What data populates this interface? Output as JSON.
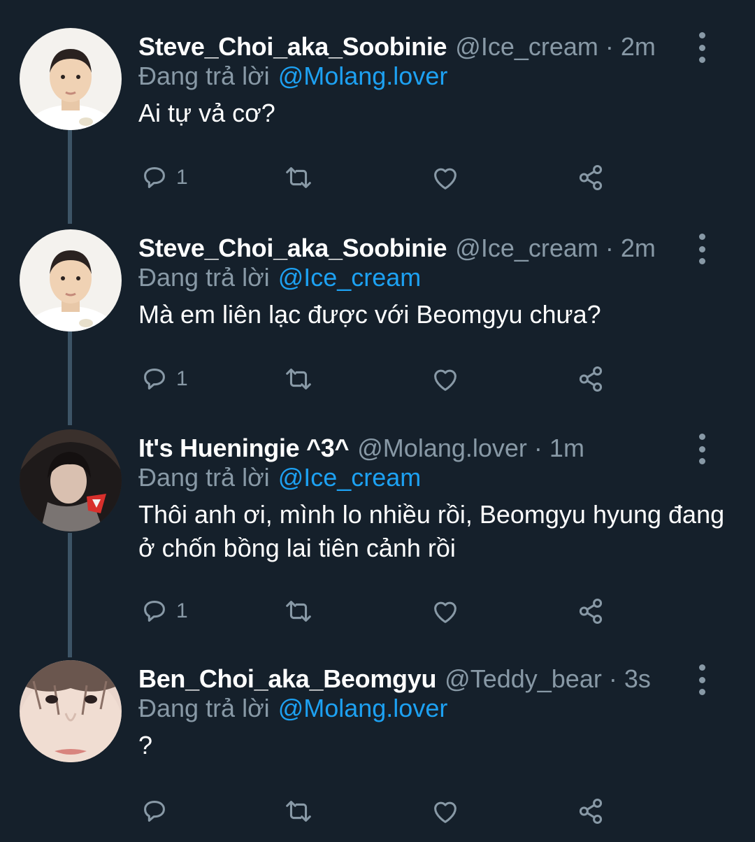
{
  "tweets": [
    {
      "display_name": "Steve_Choi_aka_Soobinie",
      "handle": "@Ice_cream",
      "separator": "·",
      "time": "2m",
      "reply_prefix": "Đang trả lời",
      "reply_target": "@Molang.lover",
      "text": "Ai tự vả cơ?",
      "reply_count": "1",
      "avatar": "photo-child-white-shirt",
      "icons": {
        "reply": "reply-icon",
        "retweet": "retweet-icon",
        "like": "like-icon",
        "share": "share-icon"
      }
    },
    {
      "display_name": "Steve_Choi_aka_Soobinie",
      "handle": "@Ice_cream",
      "separator": "·",
      "time": "2m",
      "reply_prefix": "Đang trả lời",
      "reply_target": "@Ice_cream",
      "text": "Mà em liên lạc được với Beomgyu chưa?",
      "reply_count": "1",
      "avatar": "photo-child-white-shirt",
      "icons": {
        "reply": "reply-icon",
        "retweet": "retweet-icon",
        "like": "like-icon",
        "share": "share-icon"
      }
    },
    {
      "display_name": "It's Hueningie ^3^",
      "handle": "@Molang.lover",
      "separator": "·",
      "time": "1m",
      "reply_prefix": "Đang trả lời",
      "reply_target": "@Ice_cream",
      "text": "Thôi anh ơi, mình lo nhiều rồi, Beomgyu hyung đang ở chốn bồng lai tiên cảnh rồi",
      "reply_count": "1",
      "avatar": "photo-person-dark-hoodie",
      "icons": {
        "reply": "reply-icon",
        "retweet": "retweet-icon",
        "like": "like-icon",
        "share": "share-icon"
      }
    },
    {
      "display_name": "Ben_Choi_aka_Beomgyu",
      "handle": "@Teddy_bear",
      "separator": "·",
      "time": "3s",
      "reply_prefix": "Đang trả lời",
      "reply_target": "@Molang.lover",
      "text": "?",
      "reply_count": "",
      "avatar": "photo-face-closeup",
      "icons": {
        "reply": "reply-icon",
        "retweet": "retweet-icon",
        "like": "like-icon",
        "share": "share-icon"
      }
    }
  ],
  "colors": {
    "background": "#15202b",
    "secondary_text": "#8899a6",
    "link": "#1da1f2",
    "thread_line": "#3d5466"
  }
}
